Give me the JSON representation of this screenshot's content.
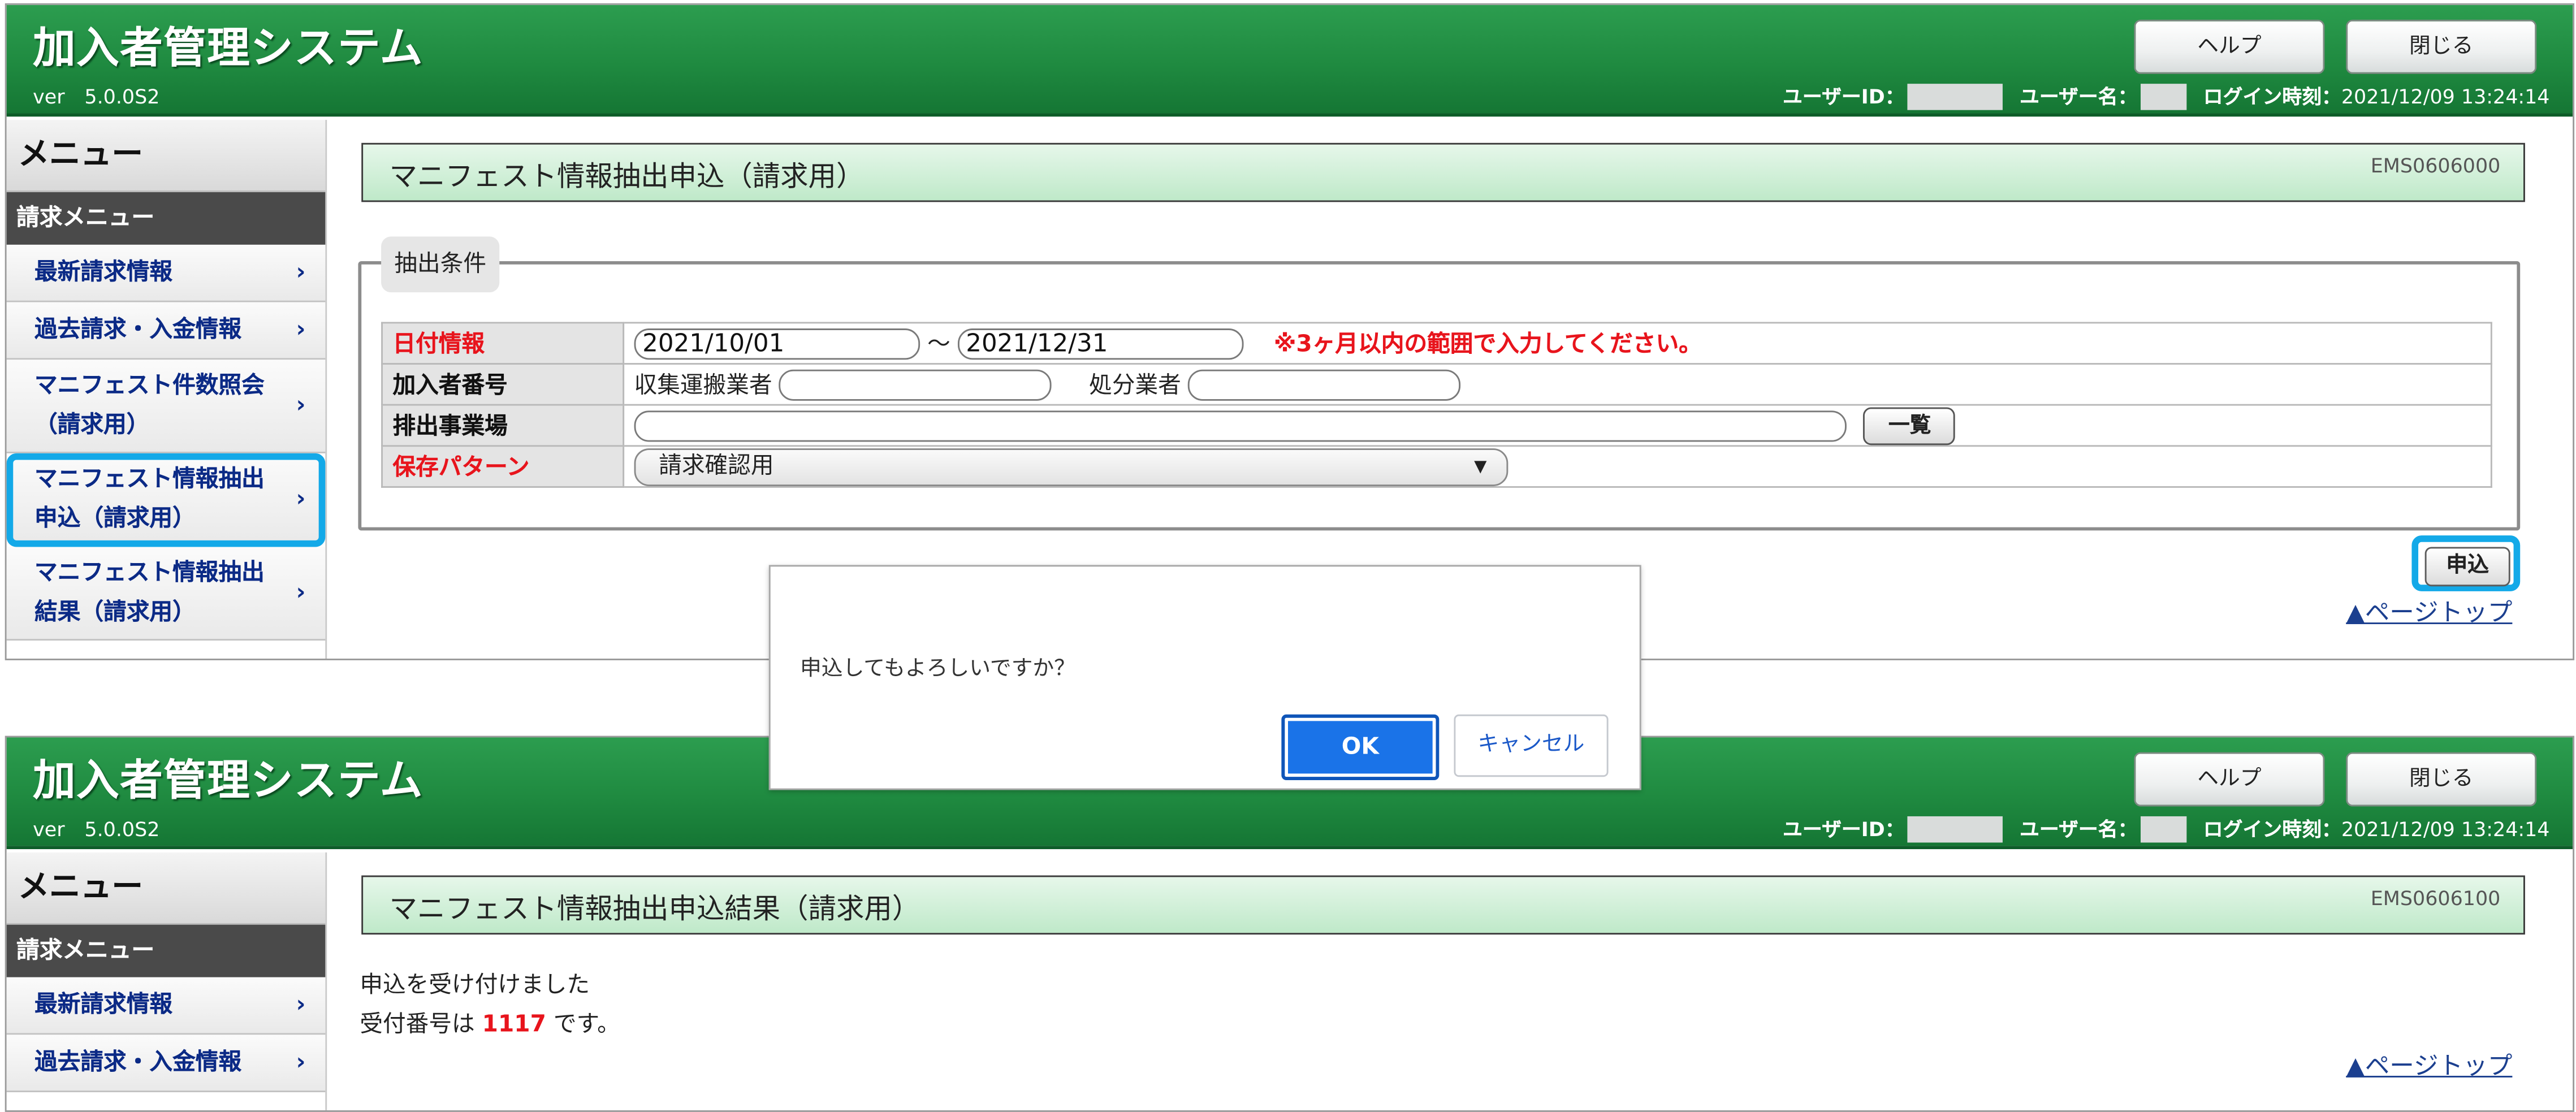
{
  "app": {
    "title": "加入者管理システム",
    "version": "ver　5.0.0S2",
    "help_label": "ヘルプ",
    "close_label": "閉じる",
    "user_id_label": "ユーザーID：",
    "user_name_label": "ユーザー名：",
    "login_time_label": "ログイン時刻：",
    "login_time": "2021/12/09 13:24:14"
  },
  "sidebar": {
    "title": "メニュー",
    "section": "請求メニュー",
    "items": [
      {
        "label": "最新請求情報"
      },
      {
        "label": "過去請求・入金情報"
      },
      {
        "label": "マニフェスト件数照会（請求用）"
      },
      {
        "label": "マニフェスト情報抽出申込（請求用）"
      },
      {
        "label": "マニフェスト情報抽出結果（請求用）"
      }
    ],
    "chevron": "›"
  },
  "screen1": {
    "title": "マニフェスト情報抽出申込（請求用）",
    "code": "EMS0606000",
    "legend": "抽出条件",
    "rows": {
      "date_label": "日付情報",
      "date_from": "2021/10/01",
      "date_sep": "～",
      "date_to": "2021/12/31",
      "date_note": "※3ヶ月以内の範囲で入力してください。",
      "member_label": "加入者番号",
      "collector_label": "収集運搬業者",
      "disposer_label": "処分業者",
      "site_label": "排出事業場",
      "list_button": "一覧",
      "pattern_label": "保存パターン",
      "pattern_value": "請求確認用",
      "pattern_arrow": "▼"
    },
    "submit_label": "申込",
    "page_top": "▲ページトップ"
  },
  "dialog": {
    "message": "申込してもよろしいですか？",
    "ok_label": "OK",
    "cancel_label": "キャンセル"
  },
  "screen2": {
    "title": "マニフェスト情報抽出申込結果（請求用）",
    "code": "EMS0606100",
    "line1": "申込を受け付けました",
    "line2_prefix": "受付番号は",
    "receipt_number": "1117",
    "line2_suffix": "です。",
    "page_top": "▲ページトップ"
  },
  "colors": {
    "header_green": "#1f8a40",
    "highlight_blue": "#13a9e8",
    "required_red": "#e8141c",
    "menu_text": "#0b2a86",
    "ok_blue": "#1a73e8"
  }
}
